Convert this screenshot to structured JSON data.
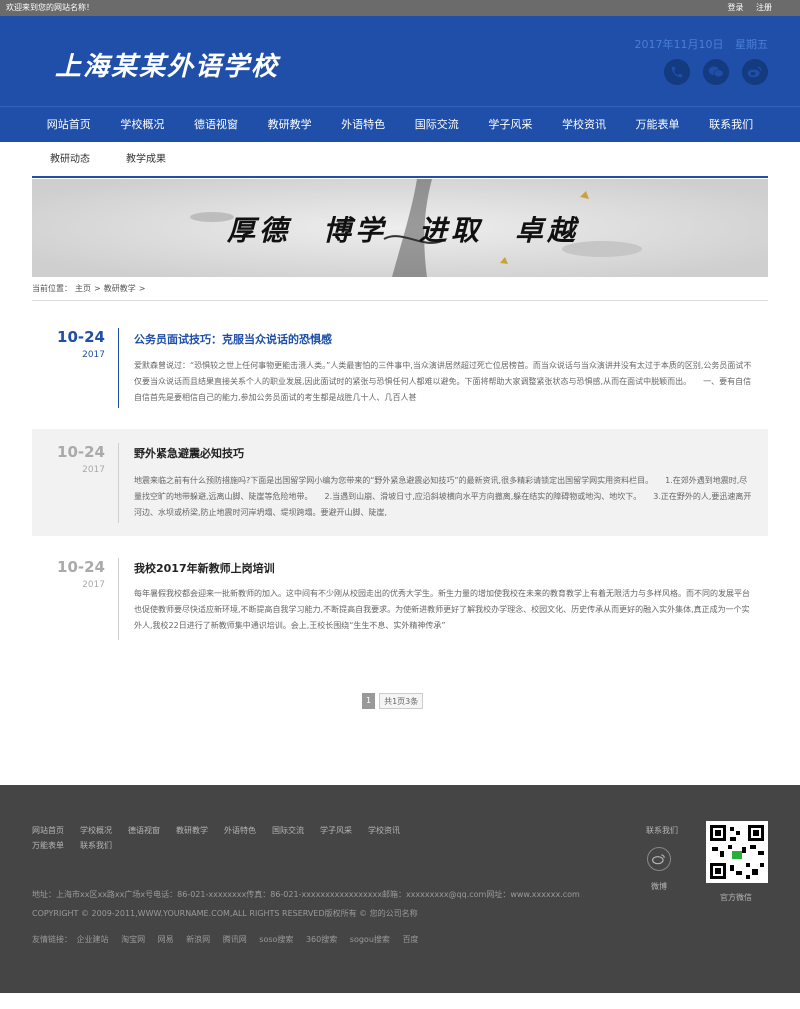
{
  "topbar": {
    "welcome": "欢迎来到您的网站名称！",
    "login": "登录",
    "register": "注册"
  },
  "header": {
    "logo": "上海某某外语学校",
    "date": "2017年11月10日",
    "weekday": "星期五",
    "social": [
      {
        "icon": "phone-icon"
      },
      {
        "icon": "wechat-icon"
      },
      {
        "icon": "weibo-icon"
      }
    ]
  },
  "nav": [
    "网站首页",
    "学校概况",
    "德语视窗",
    "教研教学",
    "外语特色",
    "国际交流",
    "学子风采",
    "学校资讯",
    "万能表单",
    "联系我们"
  ],
  "subnav": [
    "教研动态",
    "教学成果"
  ],
  "banner": {
    "slogan": [
      "厚德",
      "博学",
      "进取",
      "卓越"
    ]
  },
  "breadcrumb": {
    "prefix": "当前位置：",
    "home": "主页",
    "sep": ">",
    "current": "教研教学",
    "tail": ">"
  },
  "articles": [
    {
      "md": "10-24",
      "year": "2017",
      "title": "公务员面试技巧：克服当众说话的恐惧感",
      "body": "爱默森曾说过：“恐惧较之世上任何事物更能击溃人类。”人类最害怕的三件事中,当众演讲居然超过死亡位居榜首。而当众说话与当众演讲并没有太过于本质的区别,公务员面试不仅要当众说话而且结果直接关系个人的职业发展,因此面试时的紧张与恐惧任何人都难以避免。下面将帮助大家调整紧张状态与恐惧感,从而在面试中脱颖而出。　　一、要有自信　　自信首先是要相信自己的能力,参加公务员面试的考生都是战胜几十人、几百人甚"
    },
    {
      "md": "10-24",
      "year": "2017",
      "title": "野外紧急避震必知技巧",
      "body": "地震来临之前有什么预防措施吗?下面是出国留学网小编为您带来的“野外紧急避震必知技巧”的最新资讯,很多精彩请锁定出国留学网实用资料栏目。　　1.在郊外遇到地震时,尽量找空旷的地带躲避,远离山脚、陡崖等危险地带。　　2.当遇到山崩、滑坡日寸,应沿斜坡横向水平方向撤离,躲在结实的障碍物或地沟、地坎下。　　3.正在野外的人,要迅速离开河边、水坝或桥梁,防止地震时河岸坍塌、堤坝跨塌。要避开山脚、陡崖,"
    },
    {
      "md": "10-24",
      "year": "2017",
      "title": "我校2017年新教师上岗培训",
      "body": "每年暑假我校都会迎来一批新教师的加入。这中间有不少刚从校园走出的优秀大学生。新生力量的增加使我校在未来的教育教学上有着无限活力与多样风格。而不同的发展平台也促使教师要尽快适应新环境,不断提高自我学习能力,不断提高自我要求。为使新进教师更好了解我校办学理念、校园文化、历史传承从而更好的融入实外集体,真正成为一个实外人,我校22日进行了新教师集中通识培训。会上,王校长围绕“生生不息、实外精神传承”"
    }
  ],
  "pager": {
    "current": "1",
    "info": "共1页3条"
  },
  "footer": {
    "nav": [
      "网站首页",
      "学校概况",
      "德语视窗",
      "教研教学",
      "外语特色",
      "国际交流",
      "学子风采",
      "学校资讯",
      "万能表单",
      "联系我们"
    ],
    "address": "地址：上海市xx区xx路xx广场x号电话：86-021-xxxxxxxx传真：86-021-xxxxxxxxxxxxxxxxx邮箱：xxxxxxxxx@qq.com网址：www.xxxxxx.com",
    "copyright": "COPYRIGHT © 2009-2011,WWW.YOURNAME.COM,ALL RIGHTS RESERVED版权所有 © 您的公司名称",
    "links_label": "友情链接：",
    "links": [
      "企业建站",
      "淘宝网",
      "网易",
      "新浪网",
      "腾讯网",
      "soso搜索",
      "360搜索",
      "sogou搜索",
      "百度"
    ],
    "contact": "联系我们",
    "weibo": "微博",
    "wechat": "官方微信"
  },
  "colors": {
    "brand": "#1f4fa8",
    "footer_bg": "#454545",
    "topbar_bg": "#6b6b6b"
  }
}
